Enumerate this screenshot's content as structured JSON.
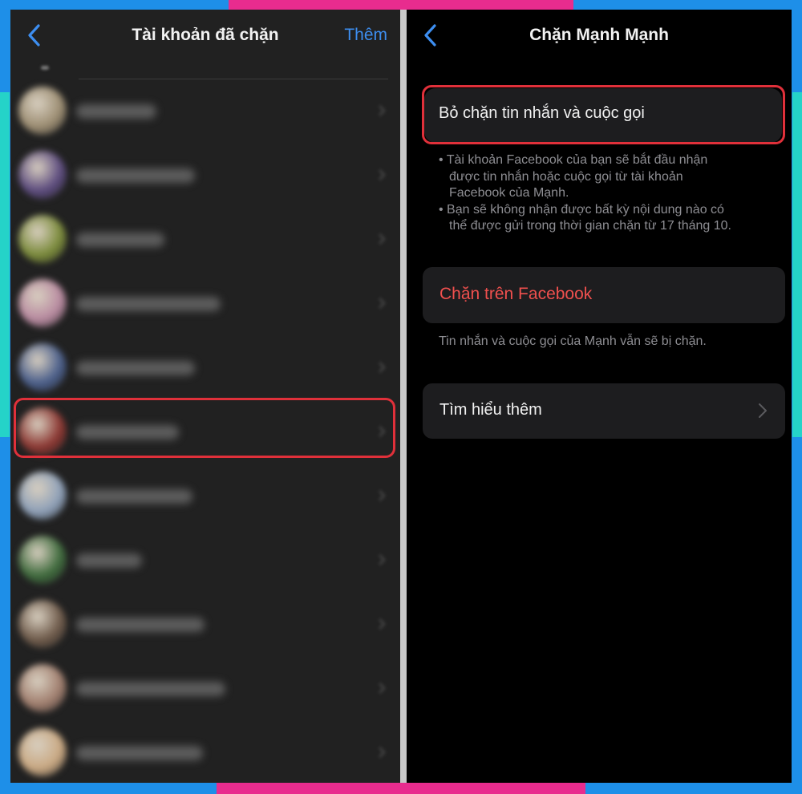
{
  "colors": {
    "frame_blue": "#1e8fe8",
    "accent_magenta": "#e82c8e",
    "accent_cyan": "#25d3c8",
    "ios_link_blue": "#3d8ef0",
    "destructive_red": "#f0504e",
    "highlight_red": "#e0303a"
  },
  "left_screen": {
    "title": "Tài khoản đã chặn",
    "back_icon": "chevron-left-icon",
    "action_label": "Thêm",
    "contacts": [
      {
        "avatar_color": "#9c8d72"
      },
      {
        "avatar_color": "#5c4b7e"
      },
      {
        "avatar_color": "#7a8a3a"
      },
      {
        "avatar_color": "#b88aa0"
      },
      {
        "avatar_color": "#4a5e8a"
      },
      {
        "avatar_color": "#8a3530"
      },
      {
        "avatar_color": "#8ea0b8"
      },
      {
        "avatar_color": "#3e6a3c"
      },
      {
        "avatar_color": "#6e5a4a"
      },
      {
        "avatar_color": "#a07e6e"
      },
      {
        "avatar_color": "#c9a882"
      }
    ],
    "highlighted_contact": 5
  },
  "right_screen": {
    "title": "Chặn Mạnh Mạnh",
    "back_icon": "chevron-left-icon",
    "unblock_label": "Bỏ chặn tin nhắn và cuộc gọi",
    "unblock_notes": [
      [
        "• Tài khoản Facebook của bạn sẽ bắt đầu nhận",
        "được tin nhắn hoặc cuộc gọi từ tài khoản",
        "Facebook của Mạnh."
      ],
      [
        "• Bạn sẽ không nhận được bất kỳ nội dung nào có",
        "thể được gửi trong thời gian chặn từ 17 tháng 10."
      ]
    ],
    "block_facebook_label": "Chặn trên Facebook",
    "block_note": "Tin nhắn và cuộc gọi của Mạnh vẫn sẽ bị chặn.",
    "learn_more_label": "Tìm hiểu thêm",
    "learn_more_icon": "chevron-right-icon"
  }
}
